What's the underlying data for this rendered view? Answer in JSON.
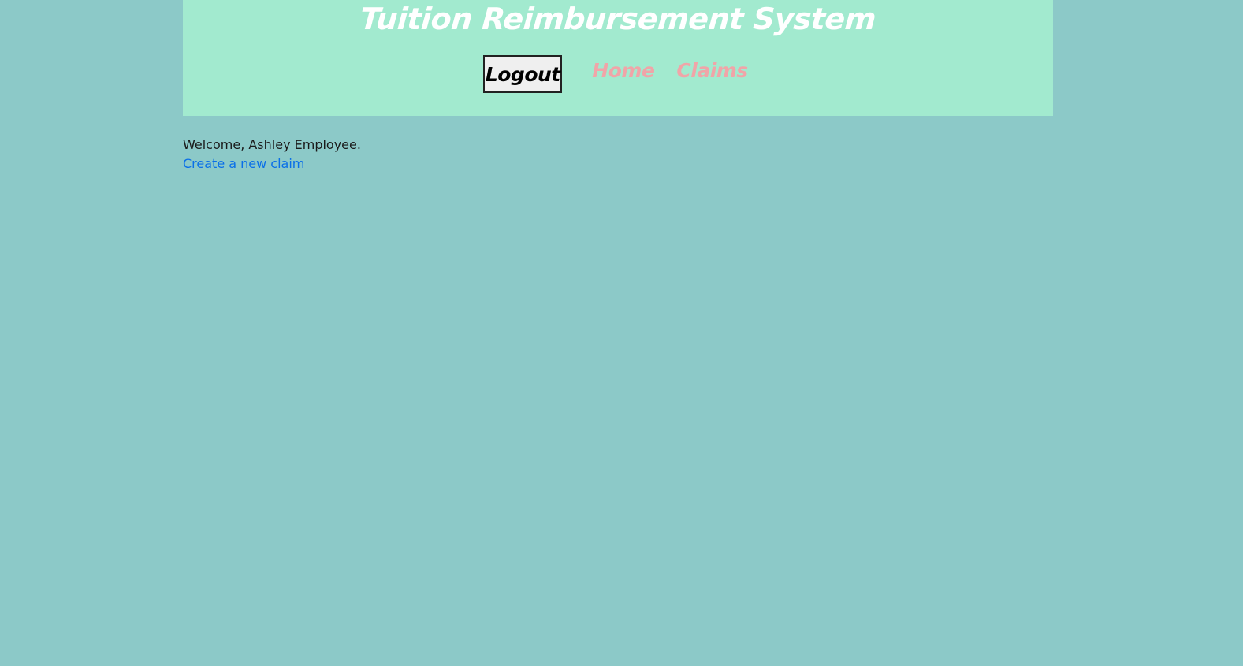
{
  "header": {
    "title": "Tuition Reimbursement System"
  },
  "nav": {
    "logout_label": "Logout",
    "links": [
      {
        "label": "Home"
      },
      {
        "label": "Claims"
      }
    ]
  },
  "main": {
    "welcome_text": "Welcome, Ashley Employee.",
    "create_claim_link": "Create a new claim"
  },
  "colors": {
    "background": "#8cc9c8",
    "header_background": "#a2eacf",
    "title_color": "#ffffff",
    "nav_link_color": "#f0a5a8",
    "link_color": "#0a6fe8"
  }
}
